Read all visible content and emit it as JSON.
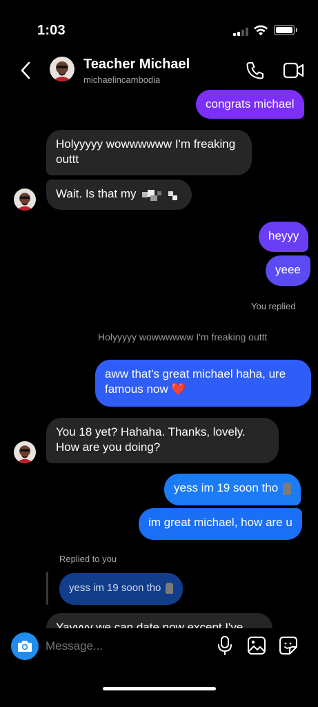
{
  "status_bar": {
    "time": "1:03"
  },
  "header": {
    "name": "Teacher Michael",
    "username": "michaelincambodia",
    "icons": [
      "back-icon",
      "phone-icon",
      "video-camera-icon"
    ]
  },
  "messages": {
    "m1": "congrats michael",
    "m2": "Holyyyyy wowwwwww I'm freaking outtt",
    "m3": "Wait.  Is that my",
    "m4": "heyyy",
    "m5": "yeee",
    "you_replied": "You replied",
    "quoted_1": "Holyyyyy wowwwwww I'm freaking outtt",
    "m6_line1": "aww that's great michael haha, ure",
    "m6_line2": "famous now",
    "m6_emoji": "❤️",
    "m7_line1": "You 18 yet?  Hahaha.   Thanks, lovely.",
    "m7_line2": "How are you doing?",
    "m8": "yess im 19 soon tho",
    "m9": "im great michael, how are u",
    "replied_to_you": "Replied to you",
    "quoted_2": "yess im 19 soon tho",
    "m10_partial": "Yayyyy we can date now except I've"
  },
  "composer": {
    "placeholder": "Message..."
  },
  "colors": {
    "background": "#000000",
    "incoming_bubble": "#262626",
    "outgoing_purple": "#7b2ff7",
    "outgoing_blue": "#1c7bf6",
    "accent_blue": "#1f8ef1"
  }
}
